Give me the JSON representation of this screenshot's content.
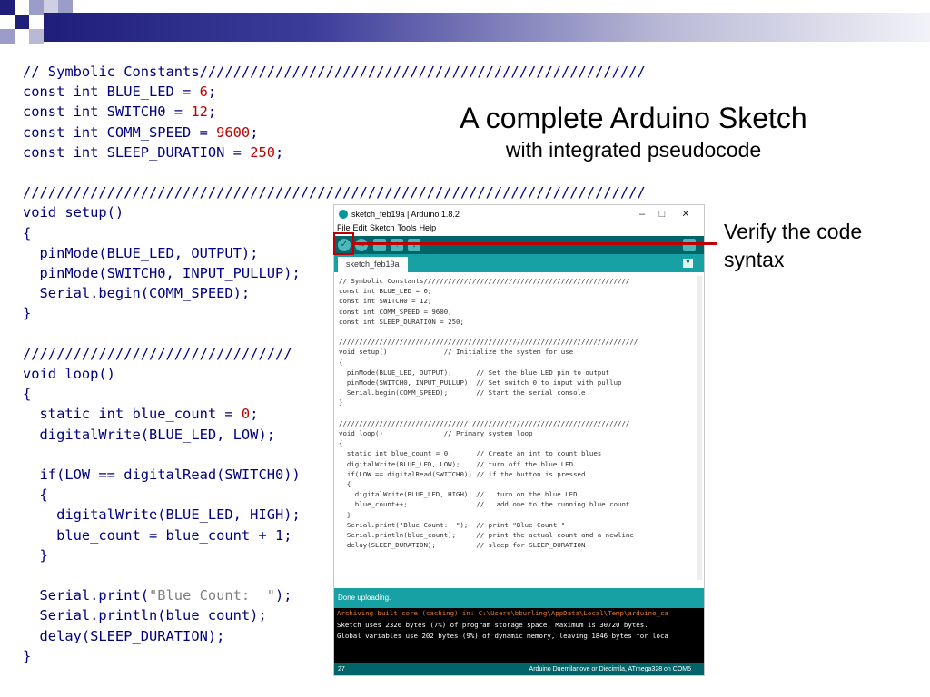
{
  "slide": {
    "title": "A complete Arduino Sketch",
    "subtitle": "with integrated pseudocode",
    "callout": "Verify the code syntax",
    "code": {
      "l1": "// Symbolic Constants/////////////////////////////////////////////////////",
      "l2a": "const int BLUE_LED = ",
      "l2n": "6",
      "l2b": ";",
      "l3a": "const int SWITCH0 = ",
      "l3n": "12",
      "l3b": ";",
      "l4a": "const int COMM_SPEED = ",
      "l4n": "9600",
      "l4b": ";",
      "l5a": "const int SLEEP_DURATION = ",
      "l5n": "250",
      "l5b": ";",
      "l7": "//////////////////////////////////////////////////////////////////////////",
      "l8": "void setup()",
      "l9": "{",
      "l10": "  pinMode(BLUE_LED, OUTPUT);",
      "l11": "  pinMode(SWITCH0, INPUT_PULLUP);",
      "l12": "  Serial.begin(COMM_SPEED);",
      "l13": "}",
      "l15": "////////////////////////////////",
      "l16": "void loop()",
      "l17": "{",
      "l18a": "  static int blue_count = ",
      "l18n": "0",
      "l18b": ";",
      "l19": "  digitalWrite(BLUE_LED, LOW);",
      "l21": "  if(LOW == digitalRead(SWITCH0))",
      "l22": "  {",
      "l23": "    digitalWrite(BLUE_LED, HIGH);",
      "l24": "    blue_count = blue_count + 1;",
      "l25": "  }",
      "l27a": "  Serial.print(",
      "l27s": "\"Blue Count:  \"",
      "l27b": ");",
      "l28": "  Serial.println(blue_count);",
      "l29": "  delay(SLEEP_DURATION);",
      "l30": "}"
    }
  },
  "ide": {
    "window_title": "sketch_feb19a | Arduino 1.8.2",
    "menu": [
      "File",
      "Edit",
      "Sketch",
      "Tools",
      "Help"
    ],
    "tab": "sketch_feb19a",
    "editor_lines": [
      "// Symbolic Constants///////////////////////////////////////////////////",
      "const int BLUE_LED = 6;",
      "const int SWITCH0 = 12;",
      "const int COMM_SPEED = 9600;",
      "const int SLEEP_DURATION = 250;",
      "",
      "//////////////////////////////////////////////////////////////////////////",
      "void setup()              // Initialize the system for use",
      "{",
      "  pinMode(BLUE_LED, OUTPUT);      // Set the blue LED pin to output",
      "  pinMode(SWITCH0, INPUT_PULLUP); // Set switch 0 to input with pullup",
      "  Serial.begin(COMM_SPEED);       // Start the serial console",
      "}",
      "",
      "//////////////////////////////// ///////////////////////////////////////",
      "void loop()               // Primary system loop",
      "{",
      "  static int blue_count = 0;      // Create an int to count blues",
      "  digitalWrite(BLUE_LED, LOW);    // turn off the blue LED",
      "  if(LOW == digitalRead(SWITCH0)) // if the button is pressed",
      "  {",
      "    digitalWrite(BLUE_LED, HIGH); //   turn on the blue LED",
      "    blue_count++;                 //   add one to the running blue count",
      "  }",
      "  Serial.print(\"Blue Count:  \");  // print \"Blue Count:\"",
      "  Serial.println(blue_count);     // print the actual count and a newline",
      "  delay(SLEEP_DURATION);          // sleep for SLEEP_DURATION"
    ],
    "status": "Done uploading.",
    "console": [
      "Archiving built core (caching) in: C:\\Users\\bburling\\AppData\\Local\\Temp\\arduino_ca",
      "Sketch uses 2326 bytes (7%) of program storage space. Maximum is 30720 bytes.",
      "Global variables use 202 bytes (9%) of dynamic memory, leaving 1846 bytes for loca"
    ],
    "footer_line": "27",
    "footer_board": "Arduino Duemilanove or Diecimila, ATmega328 on COM5"
  },
  "colors": {
    "accent_red": "#c00000",
    "ide_teal": "#006468",
    "ide_teal_light": "#17a1a5",
    "code_blue": "#000080"
  },
  "icons": [
    "verify-icon",
    "upload-icon",
    "new-icon",
    "open-icon",
    "save-icon",
    "serial-monitor-icon",
    "tab-menu-icon"
  ]
}
